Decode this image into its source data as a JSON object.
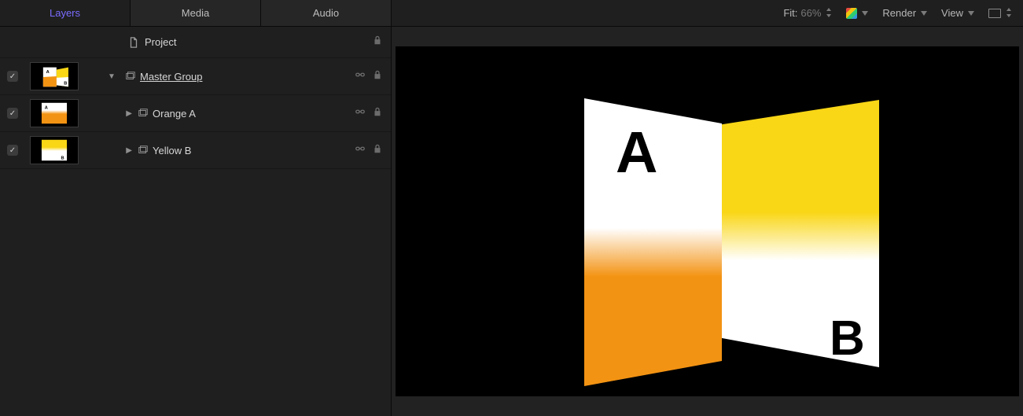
{
  "sidebar": {
    "tabs": [
      {
        "label": "Layers",
        "active": true
      },
      {
        "label": "Media",
        "active": false
      },
      {
        "label": "Audio",
        "active": false
      }
    ],
    "project": {
      "label": "Project"
    },
    "layers": [
      {
        "label": "Master Group",
        "kind": "group",
        "expanded": true,
        "visible": true,
        "underlined": true
      },
      {
        "label": "Orange A",
        "kind": "group",
        "expanded": false,
        "visible": true,
        "underlined": false
      },
      {
        "label": "Yellow B",
        "kind": "group",
        "expanded": false,
        "visible": true,
        "underlined": false
      }
    ],
    "icons": {
      "project": "document-icon",
      "group": "layers-stack-icon",
      "lock": "lock-icon",
      "link": "link-icon"
    }
  },
  "toolbar": {
    "fit_label": "Fit:",
    "fit_value": "66%",
    "render_label": "Render",
    "view_label": "View"
  },
  "canvas": {
    "letters": {
      "A": "A",
      "B": "B"
    },
    "colors": {
      "orange": "#f39313",
      "yellow": "#f9d616",
      "white": "#ffffff",
      "black": "#000000"
    }
  }
}
